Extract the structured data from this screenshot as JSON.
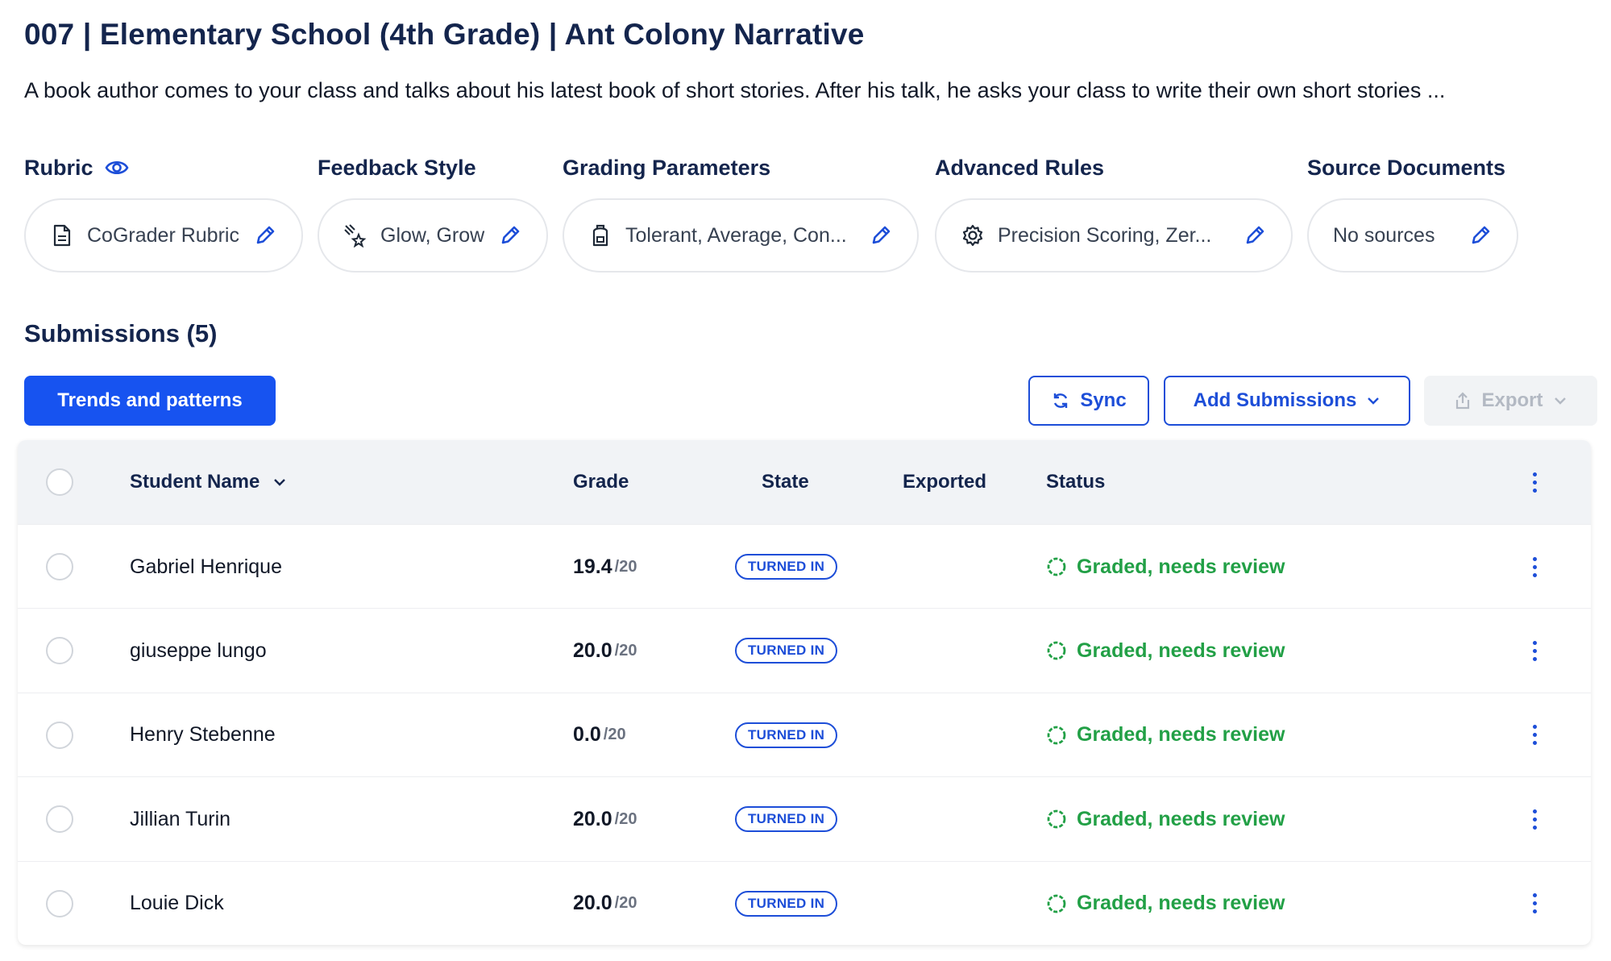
{
  "header": {
    "title": "007 | Elementary School (4th Grade) | Ant Colony Narrative",
    "description": "A book author comes to your class and talks about his latest book of short stories.  After his talk, he asks your class to write their own short stories ..."
  },
  "config": {
    "rubric": {
      "label": "Rubric",
      "value": "CoGrader Rubric"
    },
    "feedback_style": {
      "label": "Feedback Style",
      "value": "Glow, Grow"
    },
    "grading_parameters": {
      "label": "Grading Parameters",
      "value": "Tolerant, Average, Con..."
    },
    "advanced_rules": {
      "label": "Advanced Rules",
      "value": "Precision Scoring, Zer..."
    },
    "source_documents": {
      "label": "Source Documents",
      "value": "No sources"
    }
  },
  "submissions": {
    "title": "Submissions (5)",
    "trends_button": "Trends and patterns",
    "sync_button": "Sync",
    "add_button": "Add Submissions",
    "export_button": "Export"
  },
  "table": {
    "columns": {
      "student_name": "Student Name",
      "grade": "Grade",
      "state": "State",
      "exported": "Exported",
      "status": "Status"
    },
    "rows": [
      {
        "name": "Gabriel Henrique",
        "grade": "19.4",
        "max": "/20",
        "state": "TURNED IN",
        "exported": "",
        "status": "Graded, needs review"
      },
      {
        "name": "giuseppe lungo",
        "grade": "20.0",
        "max": "/20",
        "state": "TURNED IN",
        "exported": "",
        "status": "Graded, needs review"
      },
      {
        "name": "Henry Stebenne",
        "grade": "0.0",
        "max": "/20",
        "state": "TURNED IN",
        "exported": "",
        "status": "Graded, needs review"
      },
      {
        "name": "Jillian Turin",
        "grade": "20.0",
        "max": "/20",
        "state": "TURNED IN",
        "exported": "",
        "status": "Graded, needs review"
      },
      {
        "name": "Louie Dick",
        "grade": "20.0",
        "max": "/20",
        "state": "TURNED IN",
        "exported": "",
        "status": "Graded, needs review"
      }
    ]
  },
  "colors": {
    "title": "#14254d",
    "primary": "#1753f0",
    "accent": "#1d4ed8",
    "status_green": "#22a046",
    "header_bg": "#f1f3f6"
  }
}
